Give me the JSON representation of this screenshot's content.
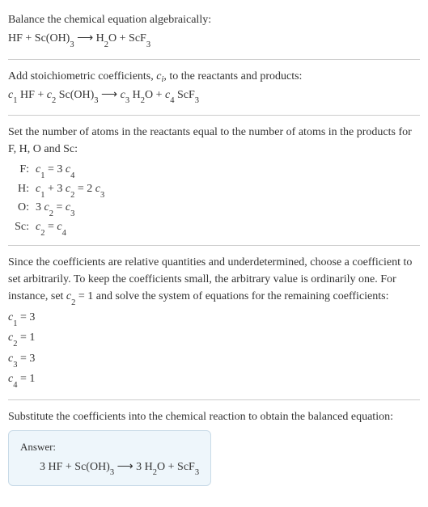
{
  "sections": {
    "balance_intro": "Balance the chemical equation algebraically:",
    "add_coeffs": "Add stoichiometric coefficients, ",
    "c_i": "c",
    "i_sub": "i",
    "add_coeffs_tail": ", to the reactants and products:",
    "set_atoms_intro": "Set the number of atoms in the reactants equal to the number of atoms in the products for F, H, O and Sc:",
    "since_text": "Since the coefficients are relative quantities and underdetermined, choose a coefficient to set arbitrarily. To keep the coefficients small, the arbitrary value is ordinarily one. For instance, set ",
    "since_c2": "c",
    "since_c2_sub": "2",
    "since_tail": " = 1 and solve the system of equations for the remaining coefficients:",
    "substitute": "Substitute the coefficients into the chemical reaction to obtain the balanced equation:",
    "answer_label": "Answer:"
  },
  "equations": {
    "unbalanced": {
      "r1": "HF + Sc(OH)",
      "r1_sub": "3",
      "arrow": "  ⟶  ",
      "p1": "H",
      "p1_sub": "2",
      "p2": "O + ScF",
      "p2_sub": "3"
    },
    "coeff_eq": {
      "c1": "c",
      "c1s": "1",
      "t1": " HF + ",
      "c2": "c",
      "c2s": "2",
      "t2": " Sc(OH)",
      "t2sub": "3",
      "arrow": "  ⟶  ",
      "c3": "c",
      "c3s": "3",
      "t3": " H",
      "t3sub": "2",
      "t4": "O + ",
      "c4": "c",
      "c4s": "4",
      "t5": " ScF",
      "t5sub": "3"
    },
    "atoms": {
      "F_label": "F:",
      "F": {
        "a": "c",
        "as": "1",
        "mid": " = 3 ",
        "b": "c",
        "bs": "4"
      },
      "H_label": "H:",
      "H": {
        "a": "c",
        "as": "1",
        "mid1": " + 3 ",
        "b": "c",
        "bs": "2",
        "mid2": " = 2 ",
        "d": "c",
        "ds": "3"
      },
      "O_label": "O:",
      "O": {
        "pre": "3 ",
        "a": "c",
        "as": "2",
        "mid": " = ",
        "b": "c",
        "bs": "3"
      },
      "Sc_label": "Sc:",
      "Sc": {
        "a": "c",
        "as": "2",
        "mid": " = ",
        "b": "c",
        "bs": "4"
      }
    },
    "solution": {
      "c1": {
        "v": "c",
        "s": "1",
        "eq": " = 3"
      },
      "c2": {
        "v": "c",
        "s": "2",
        "eq": " = 1"
      },
      "c3": {
        "v": "c",
        "s": "3",
        "eq": " = 3"
      },
      "c4": {
        "v": "c",
        "s": "4",
        "eq": " = 1"
      }
    },
    "balanced": {
      "t1": "3 HF + Sc(OH)",
      "s1": "3",
      "arrow": "  ⟶  ",
      "t2": "3 H",
      "s2": "2",
      "t3": "O + ScF",
      "s3": "3"
    }
  }
}
